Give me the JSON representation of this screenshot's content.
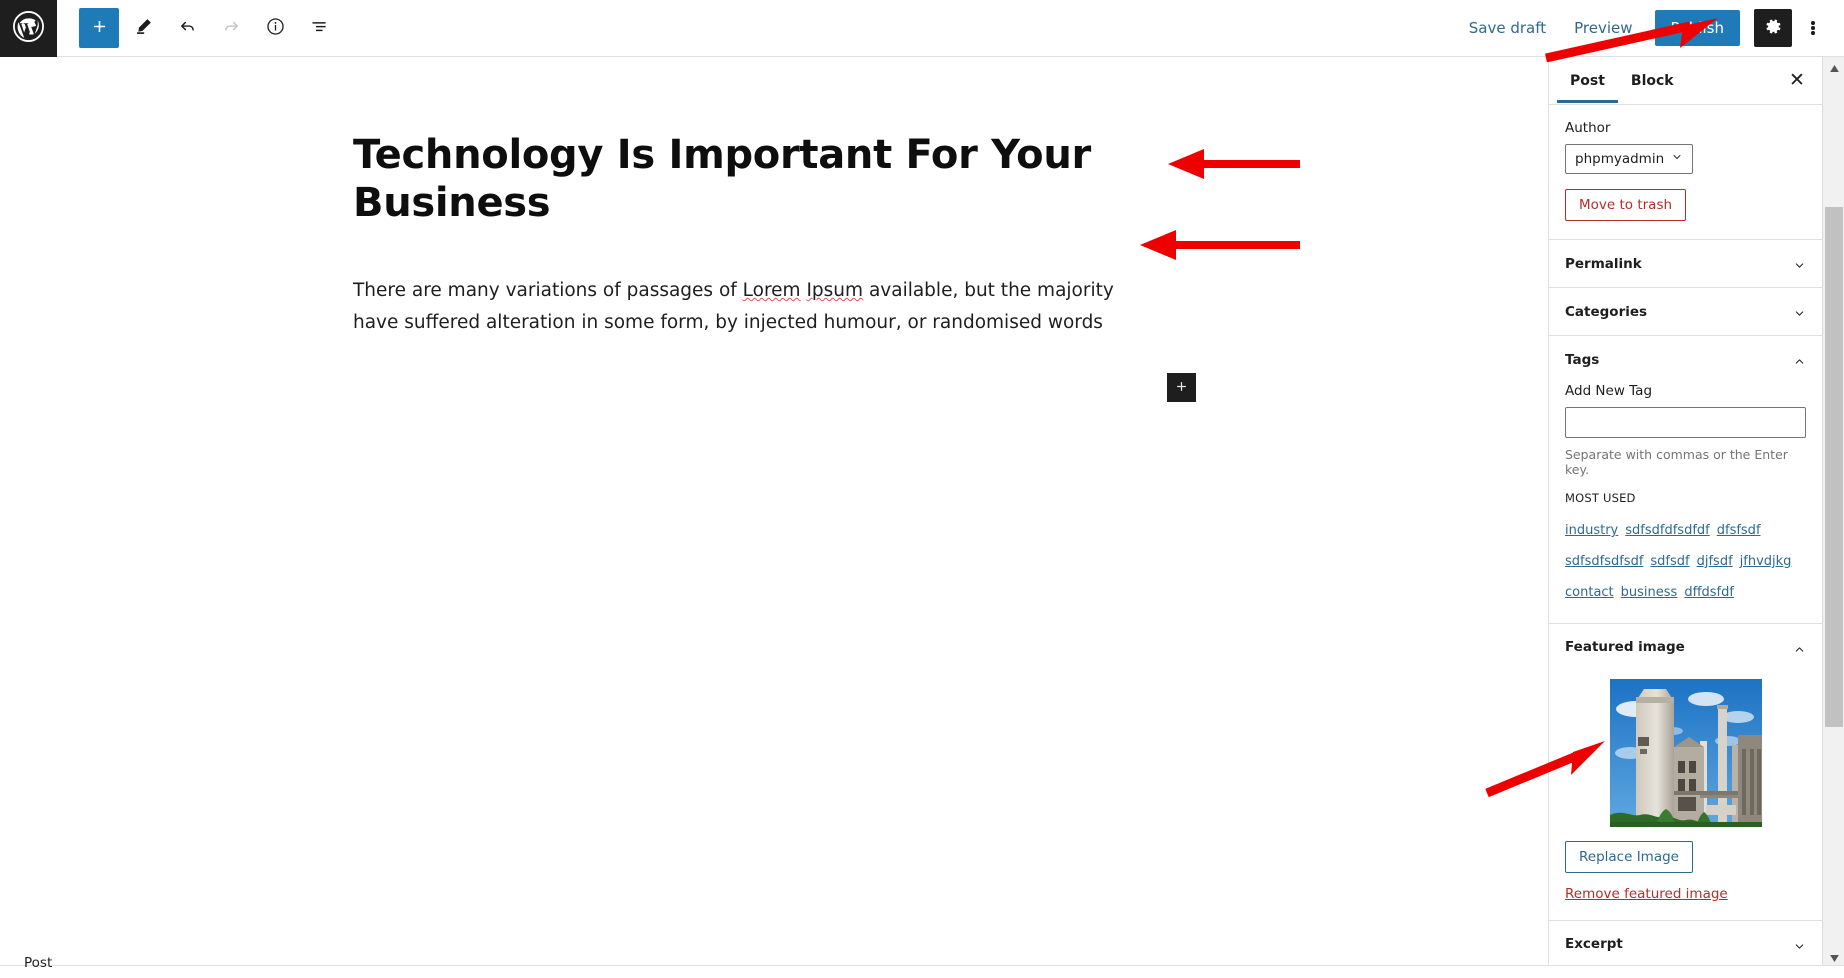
{
  "topbar": {
    "logo_icon": "wordpress-logo",
    "tools": [
      {
        "name": "add-block-toggle",
        "icon": "plus-icon",
        "label": "Toggle block inserter"
      },
      {
        "name": "edit-tool",
        "icon": "pencil-icon",
        "label": "Tools"
      },
      {
        "name": "undo",
        "icon": "undo-arrow-icon",
        "label": "Undo"
      },
      {
        "name": "redo",
        "icon": "redo-arrow-icon",
        "label": "Redo"
      },
      {
        "name": "details",
        "icon": "info-circle-icon",
        "label": "Details"
      },
      {
        "name": "list-view",
        "icon": "list-view-icon",
        "label": "List view"
      }
    ],
    "save_draft_label": "Save draft",
    "preview_label": "Preview",
    "publish_label": "Publish",
    "settings_icon": "gear-icon",
    "more_icon": "kebab-menu-icon"
  },
  "editor": {
    "title": "Technology Is Important For Your Business",
    "paragraph_part1": "There are many variations of passages of ",
    "paragraph_spell1": "Lorem",
    "paragraph_mid": " ",
    "paragraph_spell2": "Ipsum",
    "paragraph_part2": " available, but the majority have suffered alteration in some form, by injected humour, or randomised words",
    "add_block_icon": "plus-icon"
  },
  "sidebar": {
    "tabs": [
      {
        "label": "Post",
        "active": true
      },
      {
        "label": "Block",
        "active": false
      }
    ],
    "close_icon": "close-icon",
    "author": {
      "label": "Author",
      "value": "phpmyadmin",
      "chevron_icon": "chevron-down-icon"
    },
    "move_to_trash_label": "Move to trash",
    "sections": [
      {
        "title": "Permalink",
        "expanded": false
      },
      {
        "title": "Categories",
        "expanded": false
      },
      {
        "title": "Tags",
        "expanded": true
      },
      {
        "title": "Featured image",
        "expanded": true
      },
      {
        "title": "Excerpt",
        "expanded": false
      }
    ],
    "tags": {
      "add_label": "Add New Tag",
      "input_value": "",
      "help": "Separate with commas or the Enter key.",
      "most_used_label": "MOST USED",
      "items": [
        "industry",
        "sdfsdfdfsdfdf",
        "dfsfsdf",
        "sdfsdfsdfsdf",
        "sdfsdf",
        "djfsdf",
        "jfhvdjkg",
        "contact",
        "business",
        "dffdsfdf"
      ]
    },
    "featured_image": {
      "title": "Featured image",
      "alt": "industrial-cement-plant-photo",
      "replace_label": "Replace Image",
      "remove_label": "Remove featured image"
    }
  },
  "statusbar": {
    "label": "Post"
  },
  "annotations": [
    {
      "name": "arrow-to-publish",
      "direction": "up-right"
    },
    {
      "name": "arrow-to-title",
      "direction": "left"
    },
    {
      "name": "arrow-to-paragraph",
      "direction": "left"
    },
    {
      "name": "arrow-to-featured-image",
      "direction": "up-right"
    }
  ],
  "colors": {
    "accent": "#1e7bb8",
    "link": "#2d6a8e",
    "danger": "#b32d2e",
    "annotation": "#ee0000",
    "dark": "#1e1e1e"
  }
}
